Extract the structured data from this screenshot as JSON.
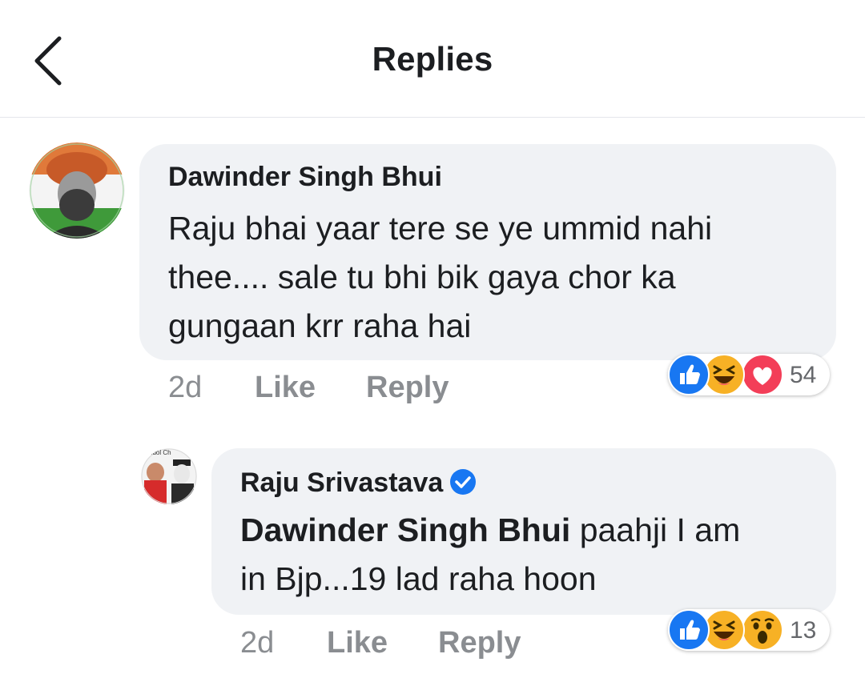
{
  "header": {
    "title": "Replies",
    "back_icon": "chevron-left-icon"
  },
  "comments": [
    {
      "author": "Dawinder Singh Bhui",
      "text_lines": [
        "Raju bhai yaar tere se ye ummid nahi",
        "thee.... sale tu bhi bik gaya chor ka",
        "gungaan krr raha hai"
      ],
      "time": "2d",
      "like_label": "Like",
      "reply_label": "Reply",
      "reactions": [
        "like",
        "haha",
        "love"
      ],
      "reaction_count": "54"
    },
    {
      "author": "Raju Srivastava",
      "verified": true,
      "mention": "Dawinder Singh Bhui",
      "text_line1_rest": " paahji I am",
      "text_line2": "in Bjp...19 lad raha hoon",
      "time": "2d",
      "like_label": "Like",
      "reply_label": "Reply",
      "reactions": [
        "like",
        "haha",
        "wow"
      ],
      "reaction_count": "13",
      "avatar_caption": "y Idol Ch"
    }
  ],
  "colors": {
    "bubble": "#f0f2f5",
    "like_blue": "#1877f2",
    "love_red": "#f33e58",
    "haha_yellow": "#f7b125",
    "meta_gray": "#8a8d91"
  }
}
